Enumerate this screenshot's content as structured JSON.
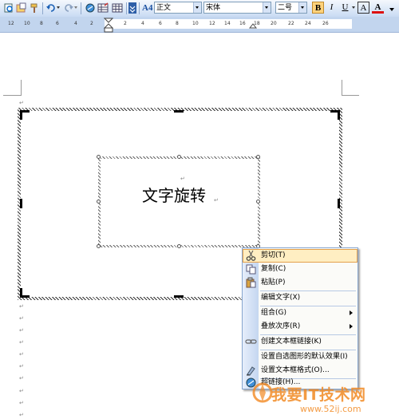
{
  "toolbar": {
    "style_value": "正文",
    "font_value": "宋体",
    "size_value": "二号",
    "bold_glyph": "B",
    "italic_glyph": "I",
    "underline_glyph": "U",
    "font_color_glyph": "A",
    "char_border_glyph": "A",
    "styles_glyph": "A4"
  },
  "ruler": {
    "labels": [
      "12",
      "10",
      "8",
      "6",
      "4",
      "2",
      "2",
      "4",
      "6",
      "8",
      "10",
      "12",
      "14",
      "16",
      "18",
      "20",
      "22",
      "24",
      "26"
    ]
  },
  "document": {
    "textbox_text": "文字旋转",
    "paragraph_mark": "↵",
    "paragraph_mark_small": "↵"
  },
  "context_menu": {
    "items": [
      {
        "label": "剪切(T)",
        "icon": "scissors-icon",
        "highlighted": true
      },
      {
        "label": "复制(C)",
        "icon": "copy-icon"
      },
      {
        "label": "粘贴(P)",
        "icon": "paste-icon"
      },
      {
        "label": "编辑文字(X)",
        "icon": ""
      },
      {
        "label": "组合(G)",
        "icon": "",
        "submenu": true
      },
      {
        "label": "叠放次序(R)",
        "icon": "",
        "submenu": true
      },
      {
        "label": "创建文本框链接(K)",
        "icon": "link-chain-icon"
      },
      {
        "label": "设置自选图形的默认效果(I)",
        "icon": ""
      },
      {
        "label": "设置文本框格式(O)...",
        "icon": "format-textbox-icon"
      },
      {
        "label": "超链接(H)...",
        "icon": "hyperlink-icon"
      }
    ]
  },
  "watermark": {
    "text": "我要IT技术网",
    "url": "www.52ij.com"
  },
  "colors": {
    "menu_highlight": "#ffeec2",
    "menu_highlight_border": "#e3a04b",
    "watermark": "#f28a23",
    "toolbar_top": "#f4f8fd",
    "toolbar_bottom": "#c9dbf3"
  }
}
